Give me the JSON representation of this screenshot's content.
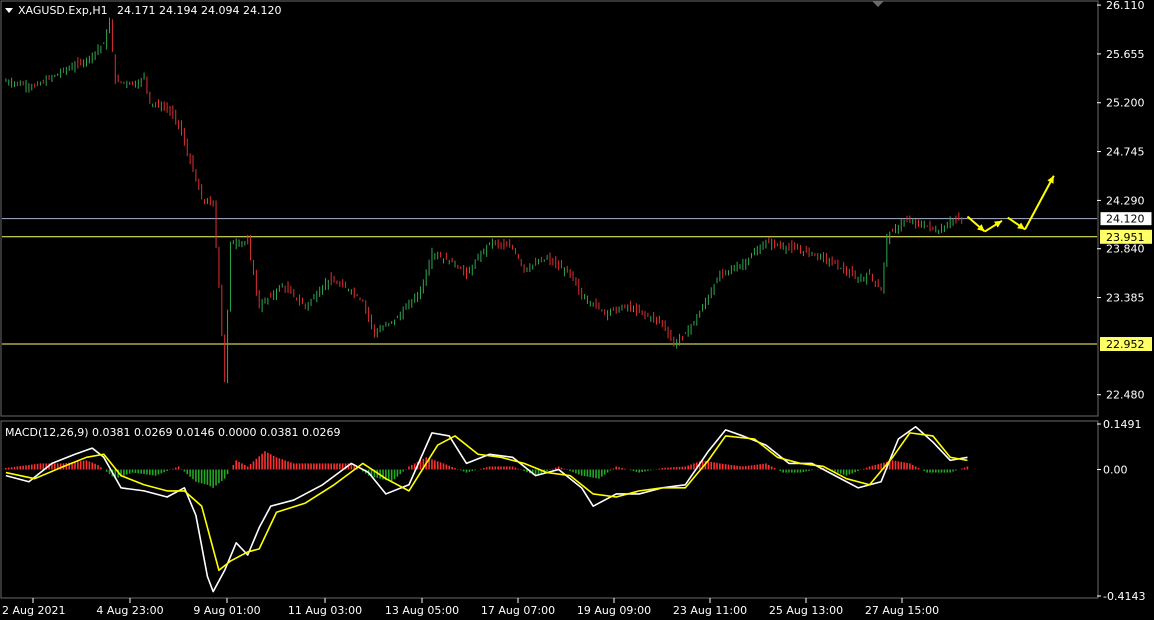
{
  "header": {
    "symbol": "XAGUSD.Exp,H1",
    "ohlc": "24.171 24.194 24.094 24.120"
  },
  "macd_header": "MACD(12,26,9) 0.0381 0.0269 0.0146 0.0000 0.0381 0.0269",
  "colors": {
    "background": "#000000",
    "bull": "#2fa84f",
    "bear": "#e03030",
    "level_line": "#ffff66",
    "current_line": "#a8b4d0",
    "macd_main": "#ffffff",
    "macd_signal": "#ffff00",
    "hist_pos": "#ff3030",
    "hist_neg": "#22aa22",
    "arrow": "#ffff00"
  },
  "chart_data": [
    {
      "type": "candlestick",
      "title": "XAGUSD.Exp,H1",
      "ylim": [
        22.3,
        26.12
      ],
      "y_ticks": [
        "26.110",
        "25.655",
        "25.200",
        "24.745",
        "24.290",
        "23.840",
        "23.385",
        "22.480"
      ],
      "x_ticks": [
        "2 Aug 2021",
        "4 Aug 23:00",
        "9 Aug 01:00",
        "11 Aug 03:00",
        "13 Aug 05:00",
        "17 Aug 07:00",
        "19 Aug 09:00",
        "23 Aug 11:00",
        "25 Aug 13:00",
        "27 Aug 15:00"
      ],
      "current_price": "24.120",
      "levels": [
        "23.951",
        "22.952"
      ],
      "close_path": [
        [
          0,
          25.4
        ],
        [
          5,
          25.35
        ],
        [
          10,
          25.5
        ],
        [
          14,
          25.6
        ],
        [
          17,
          25.75
        ],
        [
          18,
          25.95
        ],
        [
          19,
          25.4
        ],
        [
          23,
          25.38
        ],
        [
          24,
          25.45
        ],
        [
          25,
          25.2
        ],
        [
          28,
          25.15
        ],
        [
          30,
          25.0
        ],
        [
          34,
          24.3
        ],
        [
          36,
          24.25
        ],
        [
          37,
          23.5
        ],
        [
          38,
          22.6
        ],
        [
          39,
          23.9
        ],
        [
          42,
          23.9
        ],
        [
          44,
          23.3
        ],
        [
          48,
          23.5
        ],
        [
          52,
          23.3
        ],
        [
          56,
          23.55
        ],
        [
          60,
          23.45
        ],
        [
          62,
          23.35
        ],
        [
          64,
          23.05
        ],
        [
          68,
          23.2
        ],
        [
          72,
          23.45
        ],
        [
          74,
          23.8
        ],
        [
          78,
          23.7
        ],
        [
          80,
          23.6
        ],
        [
          84,
          23.9
        ],
        [
          88,
          23.85
        ],
        [
          90,
          23.65
        ],
        [
          94,
          23.75
        ],
        [
          98,
          23.6
        ],
        [
          100,
          23.4
        ],
        [
          104,
          23.25
        ],
        [
          108,
          23.3
        ],
        [
          112,
          23.2
        ],
        [
          114,
          23.15
        ],
        [
          116,
          22.95
        ],
        [
          118,
          23.05
        ],
        [
          120,
          23.2
        ],
        [
          124,
          23.6
        ],
        [
          128,
          23.7
        ],
        [
          132,
          23.9
        ],
        [
          136,
          23.85
        ],
        [
          140,
          23.8
        ],
        [
          144,
          23.7
        ],
        [
          148,
          23.55
        ],
        [
          150,
          23.6
        ],
        [
          152,
          23.45
        ],
        [
          153,
          23.95
        ],
        [
          156,
          24.1
        ],
        [
          160,
          24.05
        ],
        [
          162,
          24.0
        ],
        [
          164,
          24.1
        ],
        [
          166,
          24.12
        ]
      ],
      "arrows": [
        {
          "from": [
            167,
            24.14
          ],
          "to": [
            170,
            24.0
          ]
        },
        {
          "from": [
            170,
            24.0
          ],
          "to": [
            173,
            24.1
          ]
        },
        {
          "from": [
            174,
            24.13
          ],
          "to": [
            177,
            24.02
          ]
        },
        {
          "from": [
            177,
            24.02
          ],
          "to": [
            182,
            24.52
          ]
        }
      ]
    },
    {
      "type": "line",
      "title": "MACD(12,26,9) 0.0381 0.0269 0.0146 0.0000 0.0381 0.0269",
      "ylim": [
        -0.4143,
        0.1491
      ],
      "y_ticks": [
        "0.1491",
        "0.00",
        "-0.4143"
      ],
      "series": [
        {
          "points": [
            [
              0,
              -0.02
            ],
            [
              4,
              -0.04
            ],
            [
              8,
              0.02
            ],
            [
              12,
              0.05
            ],
            [
              15,
              0.07
            ],
            [
              17,
              0.04
            ],
            [
              20,
              -0.06
            ],
            [
              24,
              -0.07
            ],
            [
              28,
              -0.09
            ],
            [
              31,
              -0.06
            ],
            [
              33,
              -0.15
            ],
            [
              35,
              -0.35
            ],
            [
              36,
              -0.4
            ],
            [
              38,
              -0.33
            ],
            [
              40,
              -0.24
            ],
            [
              42,
              -0.28
            ],
            [
              44,
              -0.19
            ],
            [
              46,
              -0.12
            ],
            [
              50,
              -0.1
            ],
            [
              55,
              -0.05
            ],
            [
              60,
              0.02
            ],
            [
              63,
              -0.01
            ],
            [
              66,
              -0.08
            ],
            [
              70,
              -0.05
            ],
            [
              74,
              0.12
            ],
            [
              77,
              0.11
            ],
            [
              80,
              0.02
            ],
            [
              84,
              0.05
            ],
            [
              88,
              0.04
            ],
            [
              92,
              -0.02
            ],
            [
              96,
              0.0
            ],
            [
              100,
              -0.06
            ],
            [
              102,
              -0.12
            ],
            [
              106,
              -0.08
            ],
            [
              110,
              -0.08
            ],
            [
              114,
              -0.06
            ],
            [
              118,
              -0.05
            ],
            [
              122,
              0.06
            ],
            [
              125,
              0.13
            ],
            [
              128,
              0.11
            ],
            [
              132,
              0.08
            ],
            [
              136,
              0.02
            ],
            [
              140,
              0.02
            ],
            [
              144,
              -0.02
            ],
            [
              148,
              -0.06
            ],
            [
              152,
              -0.04
            ],
            [
              155,
              0.1
            ],
            [
              158,
              0.14
            ],
            [
              161,
              0.09
            ],
            [
              164,
              0.03
            ],
            [
              167,
              0.04
            ]
          ]
        },
        {
          "points": [
            [
              0,
              -0.01
            ],
            [
              5,
              -0.03
            ],
            [
              10,
              0.01
            ],
            [
              14,
              0.04
            ],
            [
              17,
              0.05
            ],
            [
              20,
              -0.02
            ],
            [
              24,
              -0.05
            ],
            [
              28,
              -0.07
            ],
            [
              31,
              -0.07
            ],
            [
              34,
              -0.12
            ],
            [
              37,
              -0.33
            ],
            [
              39,
              -0.3
            ],
            [
              42,
              -0.27
            ],
            [
              44,
              -0.26
            ],
            [
              47,
              -0.14
            ],
            [
              52,
              -0.11
            ],
            [
              57,
              -0.05
            ],
            [
              62,
              0.02
            ],
            [
              66,
              -0.03
            ],
            [
              70,
              -0.07
            ],
            [
              75,
              0.08
            ],
            [
              78,
              0.11
            ],
            [
              82,
              0.05
            ],
            [
              86,
              0.04
            ],
            [
              90,
              0.02
            ],
            [
              94,
              -0.01
            ],
            [
              98,
              -0.02
            ],
            [
              102,
              -0.08
            ],
            [
              106,
              -0.09
            ],
            [
              110,
              -0.07
            ],
            [
              114,
              -0.06
            ],
            [
              118,
              -0.06
            ],
            [
              122,
              0.03
            ],
            [
              125,
              0.11
            ],
            [
              130,
              0.1
            ],
            [
              134,
              0.04
            ],
            [
              138,
              0.02
            ],
            [
              142,
              0.01
            ],
            [
              146,
              -0.03
            ],
            [
              150,
              -0.05
            ],
            [
              154,
              0.04
            ],
            [
              157,
              0.12
            ],
            [
              161,
              0.11
            ],
            [
              164,
              0.04
            ],
            [
              167,
              0.03
            ]
          ]
        }
      ],
      "histogram_path": [
        [
          0,
          0.005
        ],
        [
          6,
          0.02
        ],
        [
          10,
          0.02
        ],
        [
          14,
          0.03
        ],
        [
          16,
          0.015
        ],
        [
          19,
          -0.03
        ],
        [
          22,
          -0.01
        ],
        [
          26,
          -0.02
        ],
        [
          30,
          0.01
        ],
        [
          33,
          -0.04
        ],
        [
          35,
          -0.05
        ],
        [
          36,
          -0.06
        ],
        [
          38,
          -0.03
        ],
        [
          40,
          0.03
        ],
        [
          42,
          0.01
        ],
        [
          45,
          0.06
        ],
        [
          47,
          0.04
        ],
        [
          50,
          0.02
        ],
        [
          55,
          0.02
        ],
        [
          60,
          0.02
        ],
        [
          63,
          -0.02
        ],
        [
          67,
          -0.04
        ],
        [
          70,
          0.01
        ],
        [
          73,
          0.04
        ],
        [
          76,
          0.02
        ],
        [
          80,
          -0.01
        ],
        [
          84,
          0.01
        ],
        [
          88,
          0.01
        ],
        [
          92,
          -0.02
        ],
        [
          96,
          0.01
        ],
        [
          100,
          -0.02
        ],
        [
          103,
          -0.03
        ],
        [
          106,
          0.01
        ],
        [
          110,
          -0.01
        ],
        [
          114,
          0.005
        ],
        [
          118,
          0.01
        ],
        [
          121,
          0.03
        ],
        [
          124,
          0.02
        ],
        [
          128,
          0.01
        ],
        [
          132,
          0.02
        ],
        [
          135,
          -0.01
        ],
        [
          138,
          -0.01
        ],
        [
          142,
          0.005
        ],
        [
          146,
          -0.02
        ],
        [
          150,
          0.01
        ],
        [
          154,
          0.03
        ],
        [
          157,
          0.02
        ],
        [
          160,
          -0.01
        ],
        [
          164,
          -0.01
        ],
        [
          167,
          0.01
        ]
      ]
    }
  ]
}
